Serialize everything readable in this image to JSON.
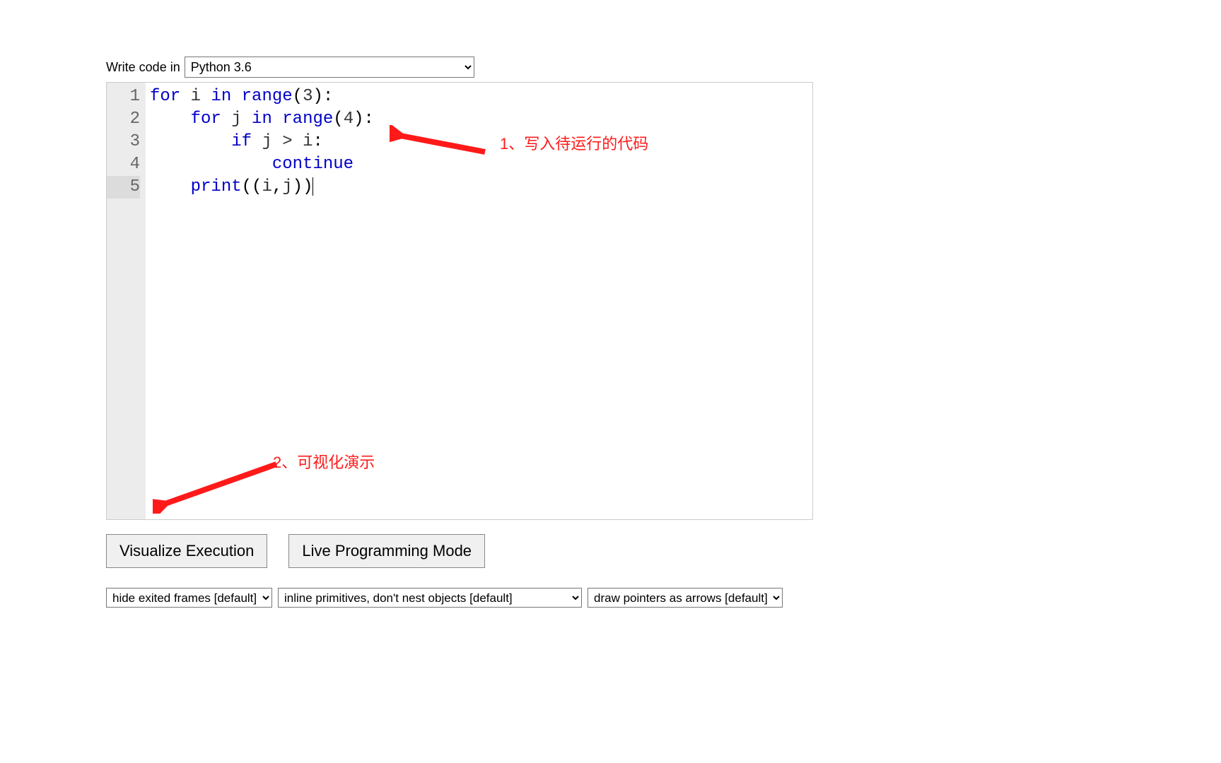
{
  "top": {
    "write_label": "Write code in",
    "language_selected": "Python 3.6"
  },
  "code": {
    "lines": [
      {
        "num": "1"
      },
      {
        "num": "2"
      },
      {
        "num": "3"
      },
      {
        "num": "4"
      },
      {
        "num": "5"
      }
    ],
    "tokens": {
      "kw_for": "for",
      "id_i": "i",
      "kw_in": "in",
      "fn_range": "range",
      "lit_3": "3",
      "lit_4": "4",
      "id_j": "j",
      "kw_if": "if",
      "op_gt": ">",
      "kw_continue": "continue",
      "fn_print": "print",
      "colon": ":",
      "comma": ",",
      "lparen": "(",
      "rparen": ")"
    }
  },
  "annotations": {
    "a1": "1、写入待运行的代码",
    "a2": "2、可视化演示"
  },
  "buttons": {
    "visualize": "Visualize Execution",
    "live": "Live Programming Mode"
  },
  "options": {
    "frames": "hide exited frames [default]",
    "primitives": "inline primitives, don't nest objects [default]",
    "pointers": "draw pointers as arrows [default]"
  }
}
